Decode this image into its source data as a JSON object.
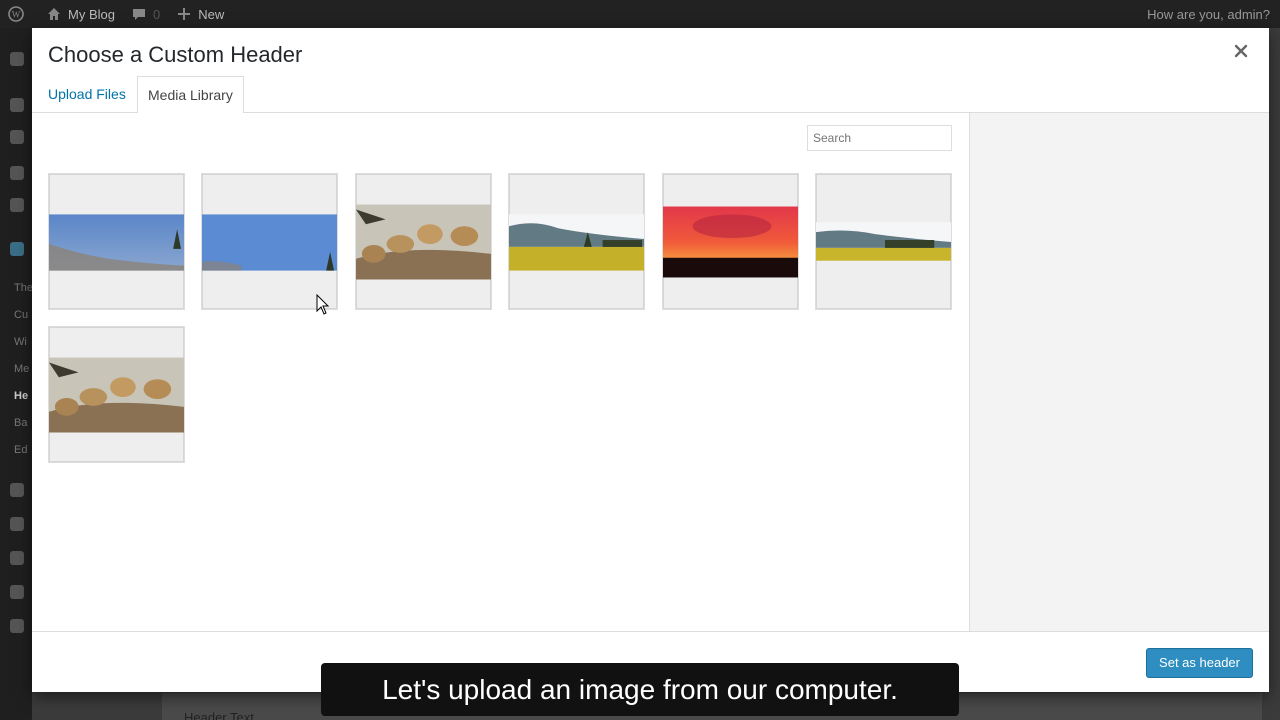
{
  "adminbar": {
    "site_name": "My Blog",
    "comments_count": "0",
    "new_label": "New",
    "greeting": "How are you, admin?"
  },
  "adminmenu": {
    "sub_items": [
      "The",
      "Cu",
      "Wi",
      "Me",
      "He",
      "Ba",
      "Ed"
    ],
    "active_sub": "He"
  },
  "page": {
    "header_text_label": "Header Text"
  },
  "modal": {
    "title": "Choose a Custom Header",
    "tabs": [
      {
        "label": "Upload Files"
      },
      {
        "label": "Media Library"
      }
    ],
    "active_tab": "Media Library",
    "search": {
      "placeholder": "Search",
      "value": ""
    },
    "thumbnails": [
      {
        "name": "blurry-sky-header",
        "scene": "sky"
      },
      {
        "name": "blue-sky-header",
        "scene": "sky"
      },
      {
        "name": "lions-header",
        "scene": "lions"
      },
      {
        "name": "field-mountains-header",
        "scene": "field"
      },
      {
        "name": "sunset-header",
        "scene": "sunset"
      },
      {
        "name": "field-wide-header",
        "scene": "field"
      },
      {
        "name": "lions-header-2",
        "scene": "lions"
      }
    ],
    "set_header_label": "Set as header"
  },
  "caption": {
    "text": "Let's upload an image from our computer."
  },
  "colors": {
    "accent": "#0073aa",
    "primary_button": "#2e8ec2"
  }
}
